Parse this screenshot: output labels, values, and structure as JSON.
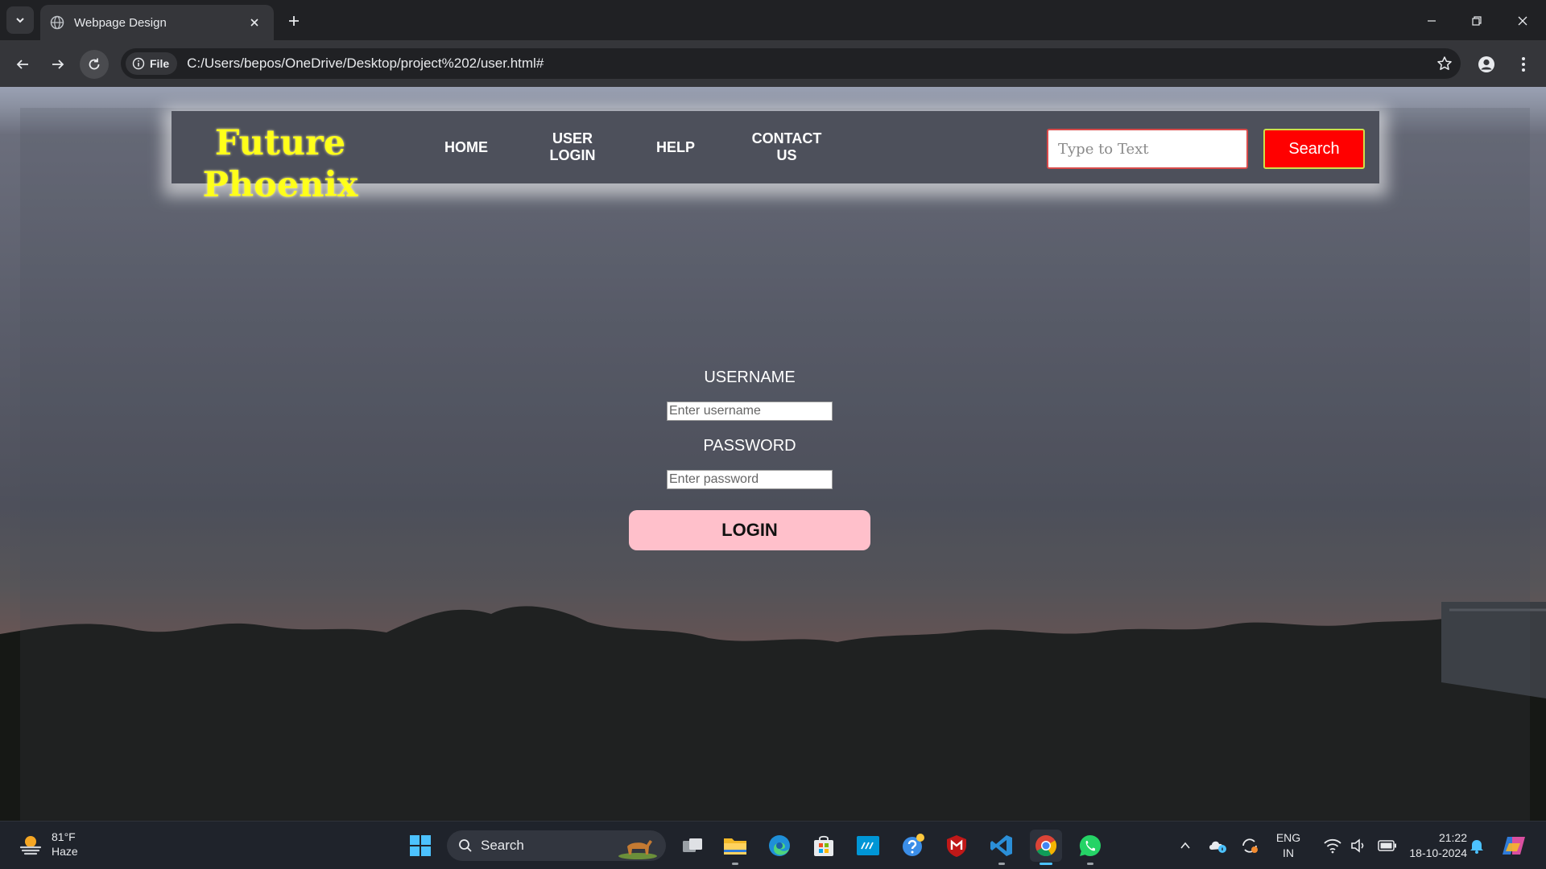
{
  "browser": {
    "tab_title": "Webpage Design",
    "site_chip_label": "File",
    "url": "C:/Users/bepos/OneDrive/Desktop/project%202/user.html#"
  },
  "site": {
    "logo_line1": "Future",
    "logo_line2": "Phoenix",
    "nav": [
      {
        "line1": "HOME",
        "line2": ""
      },
      {
        "line1": "USER",
        "line2": "LOGIN"
      },
      {
        "line1": "HELP",
        "line2": ""
      },
      {
        "line1": "CONTACT",
        "line2": "US"
      }
    ],
    "search_placeholder": "Type to Text",
    "search_button": "Search"
  },
  "login_form": {
    "username_label": "USERNAME",
    "username_placeholder": "Enter username",
    "password_label": "PASSWORD",
    "password_placeholder": "Enter password",
    "login_button": "LOGIN"
  },
  "taskbar": {
    "weather_temp": "81°F",
    "weather_desc": "Haze",
    "search_label": "Search",
    "lang_line1": "ENG",
    "lang_line2": "IN",
    "time": "21:22",
    "date": "18-10-2024"
  },
  "colors": {
    "logo": "#ffff1a",
    "search_button": "#ff0000",
    "login_button": "#ffc0cb",
    "navbar": "#4d505b"
  }
}
